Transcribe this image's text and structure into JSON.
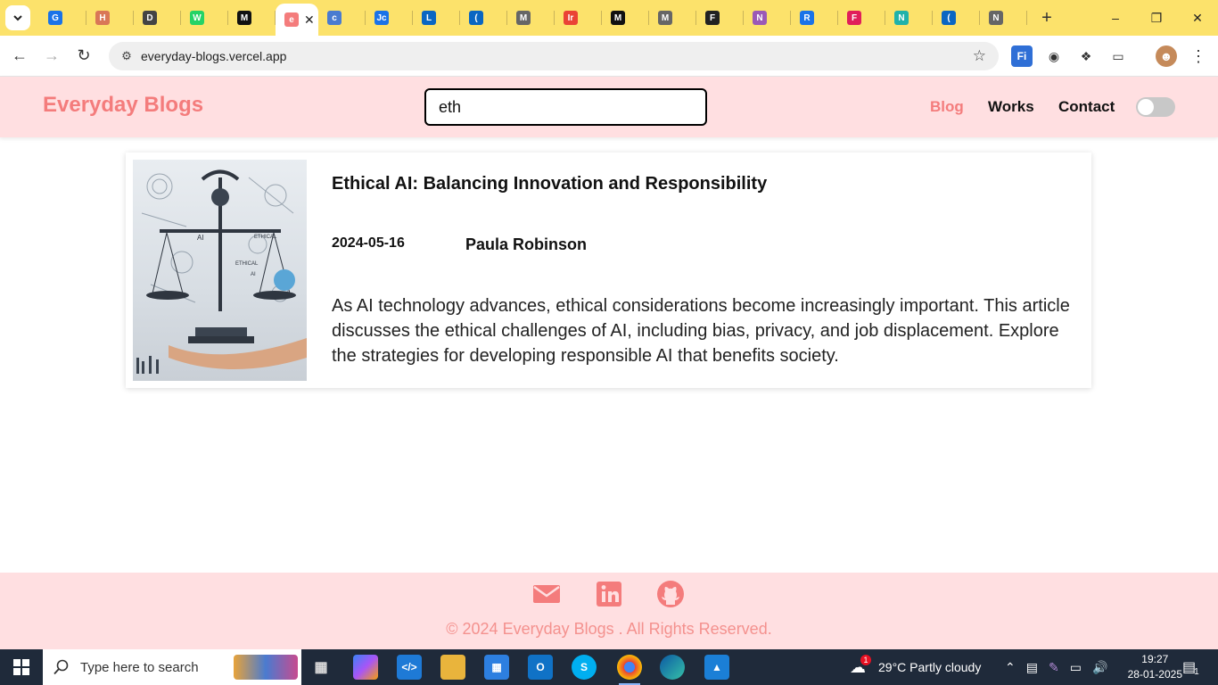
{
  "browser": {
    "tabs": [
      {
        "letter": "G",
        "color": "#1a73e8"
      },
      {
        "letter": "H",
        "color": "#d97757"
      },
      {
        "letter": "D",
        "color": "#444444"
      },
      {
        "letter": "W",
        "color": "#25d366"
      },
      {
        "letter": "M",
        "color": "#111111"
      },
      {
        "letter": "e",
        "color": "#f47c7c",
        "active": true
      },
      {
        "letter": "c",
        "color": "#4a7bd0"
      },
      {
        "letter": "Jc",
        "color": "#1a73e8"
      },
      {
        "letter": "L",
        "color": "#0a66c2"
      },
      {
        "letter": "(",
        "color": "#0a66c2"
      },
      {
        "letter": "M",
        "color": "#666666"
      },
      {
        "letter": "Ir",
        "color": "#ea4335"
      },
      {
        "letter": "M",
        "color": "#111111"
      },
      {
        "letter": "M",
        "color": "#666666"
      },
      {
        "letter": "F",
        "color": "#222222"
      },
      {
        "letter": "N",
        "color": "#9b59b6"
      },
      {
        "letter": "R",
        "color": "#1a73e8"
      },
      {
        "letter": "F",
        "color": "#e01e5a"
      },
      {
        "letter": "N",
        "color": "#20b2aa"
      },
      {
        "letter": "(",
        "color": "#0a66c2"
      },
      {
        "letter": "N",
        "color": "#666666"
      }
    ],
    "active_tab_letter": "e",
    "url": "everyday-blogs.vercel.app"
  },
  "site": {
    "brand": "Everyday Blogs",
    "search_value": "eth",
    "nav": [
      "Blog",
      "Works",
      "Contact"
    ],
    "accent_color": "#f47c7c",
    "header_bg": "#ffdfe1"
  },
  "post": {
    "title": "Ethical AI: Balancing Innovation and Responsibility",
    "date": "2024-05-16",
    "author": "Paula Robinson",
    "excerpt": "As AI technology advances, ethical considerations become increasingly important. This article discusses the ethical challenges of AI, including bias, privacy, and job displacement. Explore the strategies for developing responsible AI that benefits society.",
    "image_labels": [
      "AI",
      "ETHICAL",
      "ETHICAL",
      "AI"
    ]
  },
  "footer": {
    "copyright": "© 2024 Everyday Blogs . All Rights Reserved.",
    "social_icons": [
      "envelope-icon",
      "linkedin-icon",
      "github-icon"
    ]
  },
  "taskbar": {
    "search_placeholder": "Type here to search",
    "weather": "29°C  Partly cloudy",
    "weather_badge": "1",
    "time": "19:27",
    "date": "28-01-2025",
    "notification_count": "1"
  }
}
